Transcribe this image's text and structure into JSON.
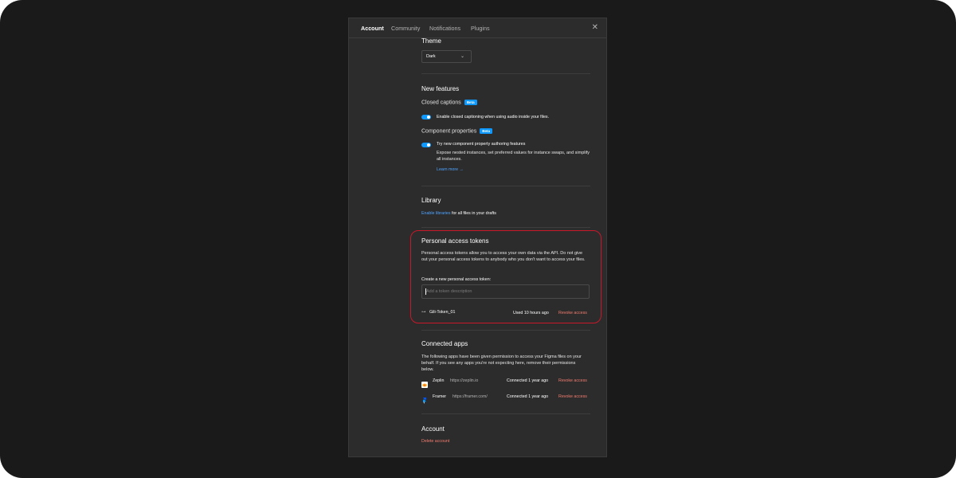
{
  "tabs": [
    "Account",
    "Community",
    "Notifications",
    "Plugins"
  ],
  "active_tab": "Account",
  "theme": {
    "heading": "Theme",
    "selected": "Dark"
  },
  "new_features": {
    "heading": "New features",
    "closed_captions": {
      "label": "Closed captions",
      "badge": "Beta",
      "toggle_label": "Enable closed captioning when using audio inside your files.",
      "enabled": true
    },
    "component_properties": {
      "label": "Component properties",
      "badge": "Beta",
      "toggle_label": "Try new component property authoring features",
      "description": "Expose nested instances, set preferred values for instance swaps, and simplify all instances.",
      "learn_more": "Learn more →",
      "enabled": true
    }
  },
  "library": {
    "heading": "Library",
    "link": "Enable libraries",
    "rest": " for all files in your drafts"
  },
  "tokens": {
    "heading": "Personal access tokens",
    "description": "Personal access tokens allow you to access your own data via the API. Do not give out your personal access tokens to anybody who you don't want to access your files.",
    "create_label": "Create a new personal access token:",
    "input_placeholder": "Add a token description",
    "items": [
      {
        "name": "Gili-Token_01",
        "used": "Used 10 hours ago",
        "action": "Revoke access"
      }
    ]
  },
  "connected_apps": {
    "heading": "Connected apps",
    "description": "The following apps have been given permission to access your Figma files on your behalf. If you see any apps you're not expecting here, remove their permissions below.",
    "apps": [
      {
        "name": "Zeplin",
        "url": "https://zeplin.io",
        "status": "Connected 1 year ago",
        "action": "Revoke access"
      },
      {
        "name": "Framer",
        "url": "https://framer.com/",
        "status": "Connected 1 year ago",
        "action": "Revoke access"
      }
    ]
  },
  "account": {
    "heading": "Account",
    "delete": "Delete account"
  },
  "colors": {
    "accent_blue": "#0d99ff",
    "revoke_red": "#f47c6f",
    "highlight": "#c8182a",
    "panel": "#2c2c2c"
  }
}
